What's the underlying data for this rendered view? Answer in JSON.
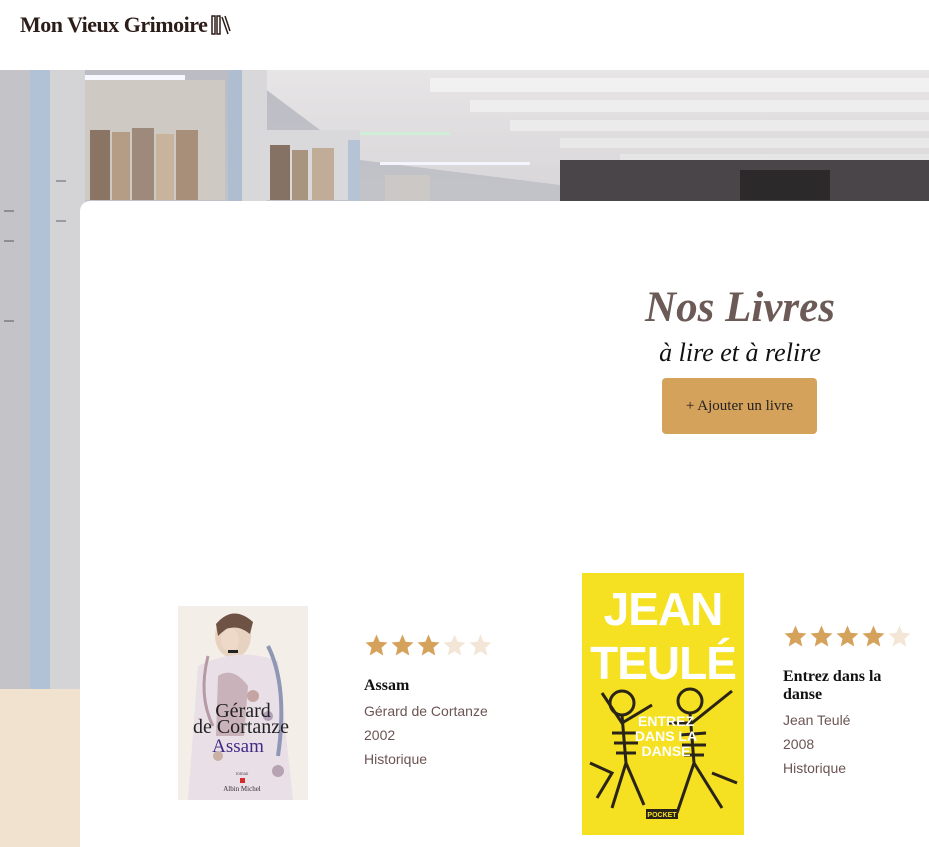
{
  "header": {
    "logo_text": "Mon Vieux Grimoire",
    "logo_icon": "books-icon"
  },
  "main": {
    "title": "Nos Livres",
    "subtitle": "à lire et à relire",
    "add_button_label": "+ Ajouter un livre"
  },
  "colors": {
    "accent": "#d5a25b",
    "star_filled": "#d5a25b",
    "star_empty": "#f3e6d6",
    "beige_band": "#f1e2cf",
    "title": "#6b5a55"
  },
  "books": [
    {
      "title": "Assam",
      "author": "Gérard de Cortanze",
      "year": "2002",
      "genre": "Historique",
      "rating": 3,
      "max_rating": 5,
      "cover": {
        "line1": "Gérard",
        "line2": "de Cortanze",
        "line3": "Assam",
        "small1": "roman",
        "publisher": "Albin Michel"
      }
    },
    {
      "title": "Entrez dans la danse",
      "author": "Jean Teulé",
      "year": "2008",
      "genre": "Historique",
      "rating": 4,
      "max_rating": 5,
      "cover": {
        "line1": "JEAN",
        "line2": "TEULÉ",
        "line3": "ENTREZ",
        "line4": "DANS LA",
        "line5": "DANSE",
        "publisher": "POCKET"
      }
    }
  ]
}
